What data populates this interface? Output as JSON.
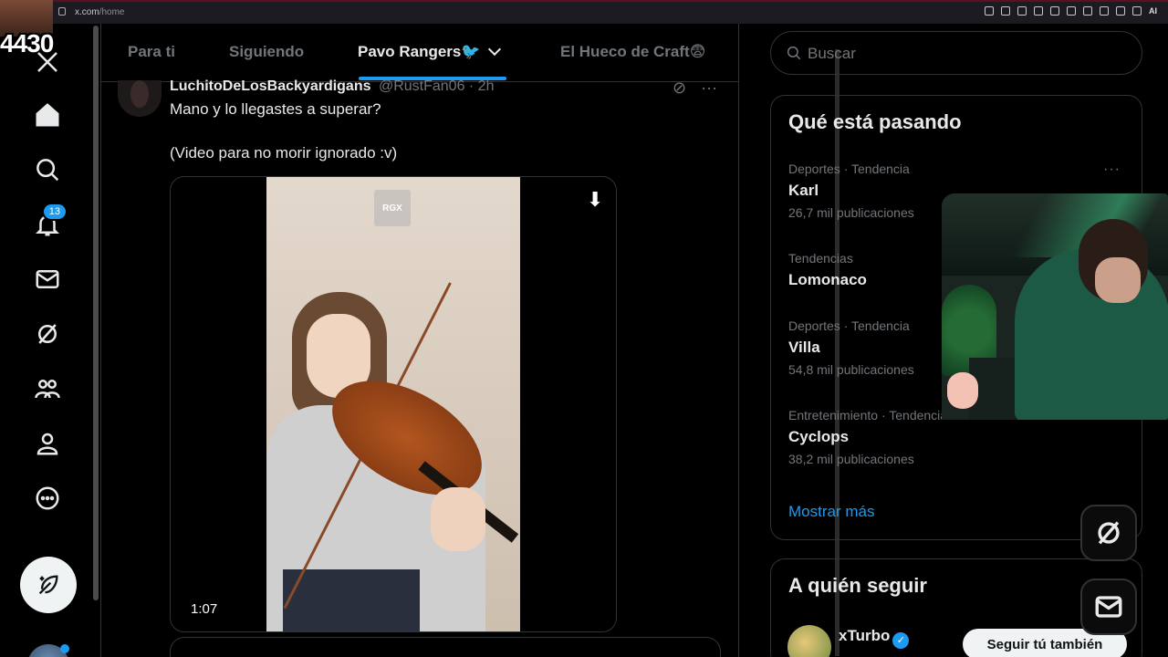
{
  "browser": {
    "domain": "x.com",
    "path": "/home"
  },
  "overlay": {
    "view_count": "4430"
  },
  "nav": {
    "notifications_badge": "13"
  },
  "tabs": [
    {
      "label": "Para ti"
    },
    {
      "label": "Siguiendo"
    },
    {
      "label": "Pavo Rangers🐦"
    },
    {
      "label": "El Hueco de Craft😨"
    }
  ],
  "tweet": {
    "name": "LuchitoDeLosBackyardigans",
    "handle": "@RustFan06 · 2h",
    "text_line1": "Mano y lo llegastes a superar?",
    "text_line2": "(Video para no morir ignorado :v)",
    "video_watermark": "RGX",
    "video_duration": "1:07"
  },
  "search": {
    "placeholder": "Buscar"
  },
  "trends": {
    "title": "Qué está pasando",
    "items": [
      {
        "meta": "Deportes · Tendencia",
        "title": "Karl",
        "count": "26,7 mil publicaciones"
      },
      {
        "meta": "Tendencias",
        "title": "Lomonaco",
        "count": ""
      },
      {
        "meta": "Deportes · Tendencia",
        "title": "Villa",
        "count": "54,8 mil publicaciones"
      },
      {
        "meta": "Entretenimiento · Tendencia",
        "title": "Cyclops",
        "count": "38,2 mil publicaciones"
      }
    ],
    "show_more": "Mostrar más"
  },
  "who_to_follow": {
    "title": "A quién seguir",
    "name": "xTurbo",
    "follow_label": "Seguir tú también"
  }
}
